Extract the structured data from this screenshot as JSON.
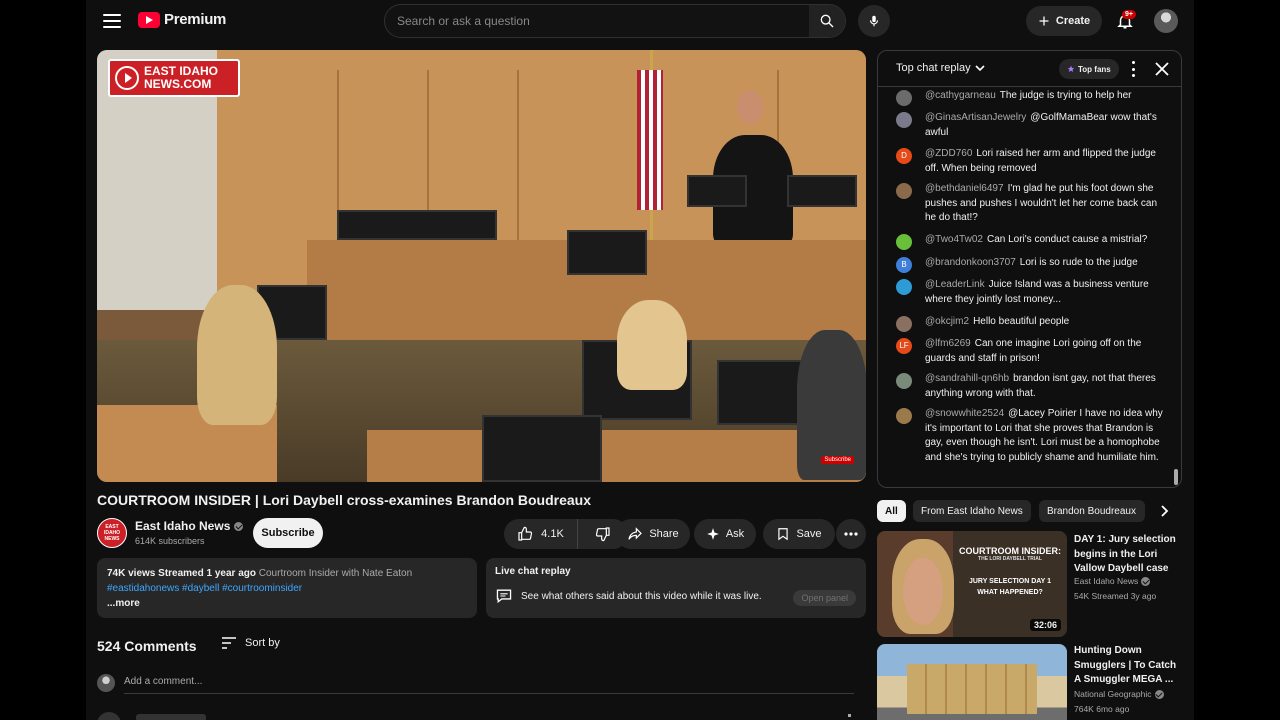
{
  "header": {
    "logo_text": "Premium",
    "search_placeholder": "Search or ask a question",
    "create_label": "Create",
    "notification_badge": "9+"
  },
  "video": {
    "watermark_text_line1": "EAST IDAHO",
    "watermark_text_line2": "NEWS.COM",
    "subscribe_watermark": "Subscribe",
    "title": "COURTROOM INSIDER | Lori Daybell cross-examines Brandon Boudreaux"
  },
  "channel": {
    "name": "East Idaho News",
    "subscribers": "614K subscribers",
    "avatar_text": "EAST IDAHO NEWS",
    "subscribe_label": "Subscribe"
  },
  "actions": {
    "likes": "4.1K",
    "share_label": "Share",
    "ask_label": "Ask",
    "save_label": "Save"
  },
  "description": {
    "stats": "74K views  Streamed 1 year ago",
    "extra": "Courtroom Insider with Nate Eaton",
    "tags": "#eastidahonews #daybell #courtroominsider",
    "more": "...more"
  },
  "live_chat": {
    "title": "Live chat replay",
    "text": "See what others said about this video while it was live.",
    "open_panel": "Open panel"
  },
  "comments": {
    "count": "524 Comments",
    "sort_label": "Sort by",
    "add_placeholder": "Add a comment..."
  },
  "chat": {
    "title": "Top chat replay",
    "top_fans": "Top fans",
    "messages": [
      {
        "author": "@cathygarneau",
        "text": "The judge is trying to help her",
        "avatar_letter": "",
        "avatar_color": "#6b6b6b"
      },
      {
        "author": "@GinasArtisanJewelry",
        "text": "@GolfMamaBear wow that's awful",
        "avatar_letter": "",
        "avatar_color": "#7a7a8a"
      },
      {
        "author": "@ZDD760",
        "text": "Lori raised her arm and flipped the judge off. When being removed",
        "avatar_letter": "D",
        "avatar_color": "#e64a19"
      },
      {
        "author": "@bethdaniel6497",
        "text": "I'm glad he put his foot down she pushes and pushes I wouldn't let her come back can he do that!?",
        "avatar_letter": "",
        "avatar_color": "#8a6a4a"
      },
      {
        "author": "@Two4Tw02",
        "text": "Can Lori's conduct cause a mistrial?",
        "avatar_letter": "",
        "avatar_color": "#6abf3a"
      },
      {
        "author": "@brandonkoon3707",
        "text": "Lori is so rude to the judge",
        "avatar_letter": "B",
        "avatar_color": "#3f7fd9"
      },
      {
        "author": "@LeaderLink",
        "text": "Juice Island was a business venture where they jointly lost money...",
        "avatar_letter": "",
        "avatar_color": "#2e9bd6"
      },
      {
        "author": "@okcjim2",
        "text": "Hello beautiful people",
        "avatar_letter": "",
        "avatar_color": "#8a7060"
      },
      {
        "author": "@lfm6269",
        "text": "Can one imagine Lori going off on the guards and staff in prison!",
        "avatar_letter": "LF",
        "avatar_color": "#e64a19"
      },
      {
        "author": "@sandrahill-qn6hb",
        "text": "brandon isnt gay, not that theres anything wrong with that.",
        "avatar_letter": "",
        "avatar_color": "#7a8a7a"
      },
      {
        "author": "@snowwhite2524",
        "text": "@Lacey Poirier I have no idea why it's important to Lori that she proves that Brandon is gay, even though he isn't. Lori must be a homophobe and she's trying to publicly shame and humiliate him.",
        "avatar_letter": "",
        "avatar_color": "#9a7a4a"
      }
    ]
  },
  "chips": [
    "All",
    "From East Idaho News",
    "Brandon Boudreaux"
  ],
  "recommendations": [
    {
      "title": "DAY 1: Jury selection begins in the Lori Vallow Daybell case",
      "channel": "East Idaho News",
      "meta": "54K  Streamed 3y ago",
      "duration": "32:06",
      "thumb_line1": "COURTROOM INSIDER:",
      "thumb_line2": "THE LORI DAYBELL TRIAL",
      "thumb_line3": "JURY SELECTION DAY 1",
      "thumb_line4": "WHAT HAPPENED?"
    },
    {
      "title": "Hunting Down Smugglers | To Catch A Smuggler MEGA ...",
      "channel": "National Geographic",
      "meta": "764K  6mo ago"
    }
  ],
  "colors": {
    "accent_red": "#ff0033",
    "link_blue": "#3ea6ff",
    "background": "#0f0f0f"
  }
}
